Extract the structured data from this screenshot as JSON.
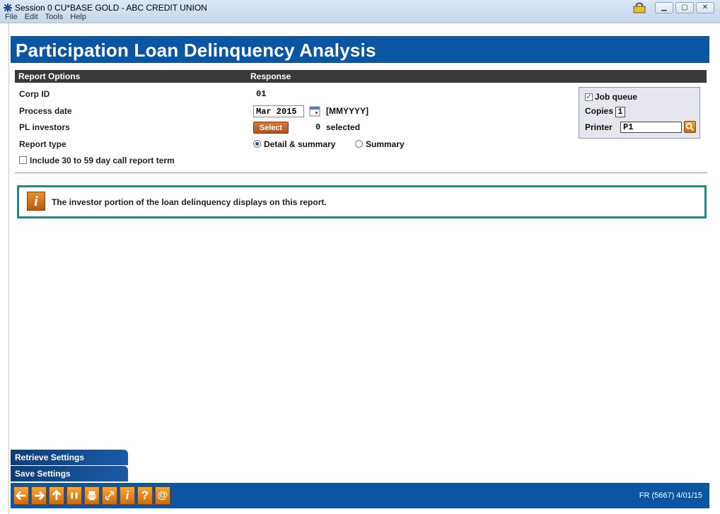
{
  "window": {
    "title": "Session 0 CU*BASE GOLD - ABC CREDIT UNION",
    "menu": [
      "File",
      "Edit",
      "Tools",
      "Help"
    ],
    "buttons": [
      "minimize",
      "maximize",
      "close"
    ]
  },
  "page": {
    "title": "Participation Loan Delinquency Analysis"
  },
  "header": {
    "col1": "Report Options",
    "col2": "Response"
  },
  "fields": {
    "corp_id": {
      "label": "Corp ID",
      "value": "01"
    },
    "process_date": {
      "label": "Process date",
      "value": "Mar 2015",
      "format": "[MMYYYY]"
    },
    "pl_investors": {
      "label": "PL investors",
      "button": "Select",
      "count": "0",
      "count_label": "selected"
    },
    "report_type": {
      "label": "Report type",
      "options": [
        "Detail & summary",
        "Summary"
      ],
      "selected": "Detail & summary"
    },
    "include_30_59": {
      "label": "Include 30 to 59 day call report term",
      "checked": false
    }
  },
  "job": {
    "job_queue_label": "Job queue",
    "job_queue_checked": true,
    "copies_label": "Copies",
    "copies": "1",
    "printer_label": "Printer",
    "printer": "P1"
  },
  "info": {
    "message": "The investor portion of the loan delinquency displays on this report."
  },
  "side_buttons": {
    "retrieve": "Retrieve Settings",
    "save": "Save Settings"
  },
  "toolbar": {
    "icons": [
      "back-arrow-icon",
      "forward-arrow-icon",
      "up-arrow-icon",
      "pause-icon",
      "print-icon",
      "link-icon",
      "info-icon",
      "help-icon",
      "email-icon"
    ],
    "status": "FR (5667) 4/01/15"
  },
  "colors": {
    "banner": "#0b56a3",
    "accent_orange": "#d06a0d",
    "info_border": "#1e8c84"
  }
}
